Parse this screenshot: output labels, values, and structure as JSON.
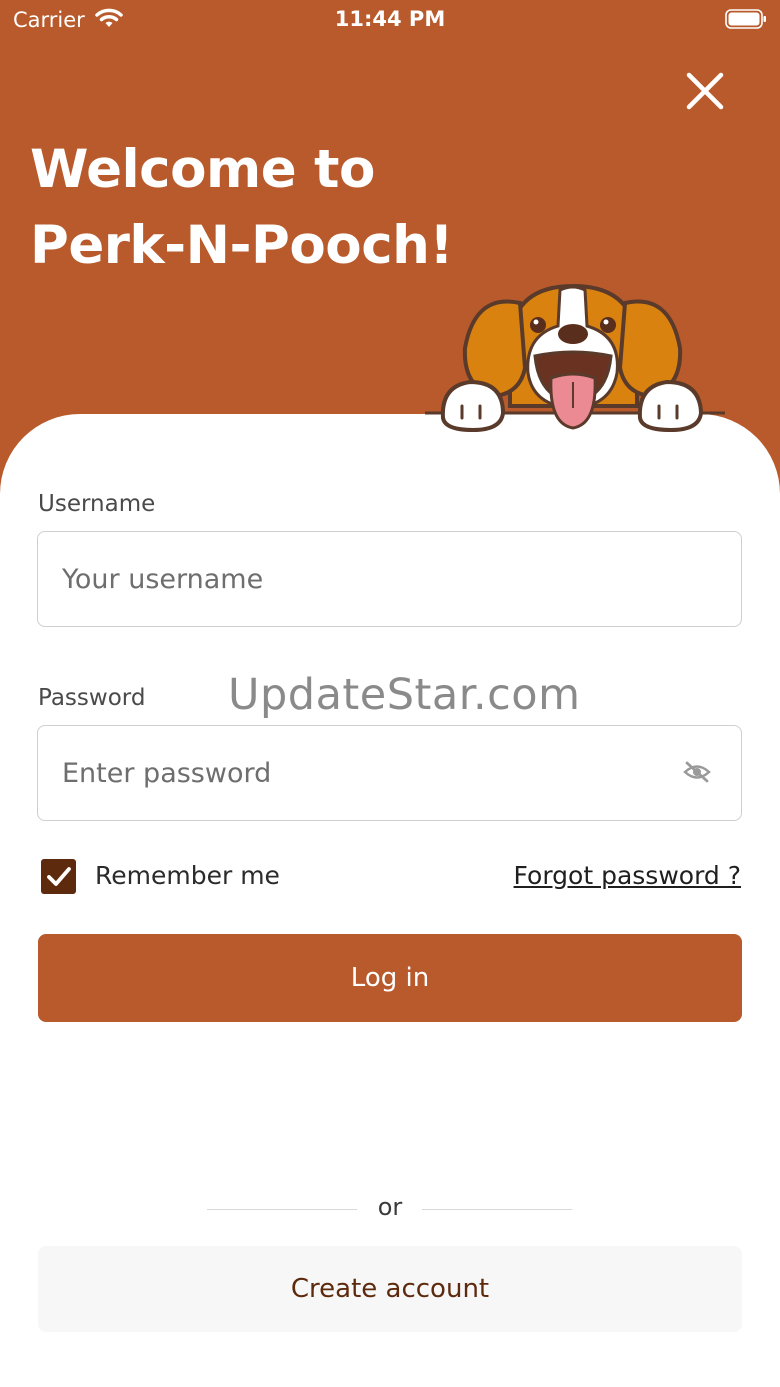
{
  "status_bar": {
    "carrier": "Carrier",
    "time": "11:44 PM"
  },
  "header": {
    "title_line1": "Welcome to",
    "title_line2": "Perk-N-Pooch!"
  },
  "form": {
    "username_label": "Username",
    "username_placeholder": "Your username",
    "password_label": "Password",
    "password_placeholder": "Enter password",
    "remember_label": "Remember me",
    "remember_checked": true,
    "forgot_label": "Forgot password ?",
    "login_label": "Log in"
  },
  "footer": {
    "or_label": "or",
    "create_label": "Create account"
  },
  "watermark": "UpdateStar.com",
  "colors": {
    "brand": "#b85a2b",
    "dark_brown": "#5e2a0e",
    "white": "#ffffff"
  }
}
